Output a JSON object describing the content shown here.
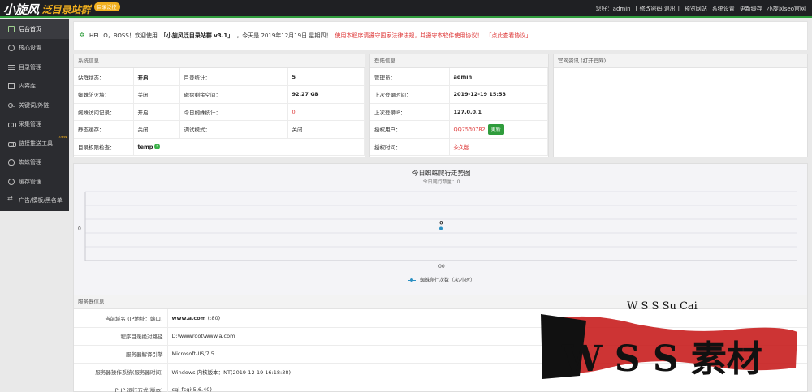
{
  "header": {
    "logo_main": "小旋风",
    "logo_accent": "泛目录站群",
    "logo_badge": "目录泛控",
    "links": [
      "您好：admin",
      "[ 修改密码 退出 ]",
      "预览网站",
      "系统设置",
      "更新缓存",
      "小旋风seo官网"
    ]
  },
  "sidebar": {
    "items": [
      {
        "label": "后台首页",
        "icon": "home-icon"
      },
      {
        "label": "核心设置",
        "icon": "gear-icon"
      },
      {
        "label": "目录管理",
        "icon": "list-icon"
      },
      {
        "label": "内容库",
        "icon": "box-icon"
      },
      {
        "label": "关键词/外链",
        "icon": "key-icon"
      },
      {
        "label": "采集管理",
        "icon": "link-icon"
      },
      {
        "label": "链接推送工具",
        "icon": "push-icon",
        "tag": "new"
      },
      {
        "label": "蜘蛛管理",
        "icon": "bug-icon"
      },
      {
        "label": "缓存管理",
        "icon": "clock-icon"
      },
      {
        "label": "广告/模板/黑名单",
        "icon": "shuffle-icon"
      }
    ]
  },
  "welcome": {
    "greeting": "HELLO，BOSS！欢迎使用",
    "product": "「小旋风泛目录站群 v3.1」",
    "date_text": "，今天是 2019年12月19日 星期四！",
    "notice": "使用本程序请遵守国家法律法规，并遵守本软件使用协议！",
    "link": "「点此查看协议」"
  },
  "system_info": {
    "title": "系统信息",
    "rows": [
      [
        "站群状态：",
        "开启",
        "目录统计：",
        "5"
      ],
      [
        "蜘蛛防火墙：",
        "关闭",
        "磁盘剩余空间：",
        "92.27 GB"
      ],
      [
        "蜘蛛访问记录：",
        "开启",
        "今日蜘蛛统计：",
        "0"
      ],
      [
        "静态缓存：",
        "关闭",
        "调试模式：",
        "关闭"
      ],
      [
        "目录权限检查：",
        "temp",
        "",
        ""
      ]
    ]
  },
  "login_info": {
    "title": "登陆信息",
    "rows": [
      [
        "管理员：",
        "admin"
      ],
      [
        "上次登录时间：",
        "2019-12-19 15:53"
      ],
      [
        "上次登录IP：",
        "127.0.0.1"
      ],
      [
        "授权用户：",
        "QQ7530782"
      ],
      [
        "授权时间：",
        "永久版"
      ]
    ],
    "update_button": "更新"
  },
  "official": {
    "title": "官网资讯 (打开官网)"
  },
  "chart": {
    "title": "今日蜘蛛爬行走势图",
    "subtitle": "今日爬行数量：0",
    "legend": "蜘蛛爬行次数（次/小时）"
  },
  "chart_data": {
    "type": "line",
    "title": "今日蜘蛛爬行走势图",
    "subtitle": "今日爬行数量：0",
    "categories": [
      "00"
    ],
    "series": [
      {
        "name": "蜘蛛爬行次数（次/小时）",
        "values": [
          0
        ]
      }
    ],
    "y_ticks": [
      "0"
    ],
    "grid": true,
    "legend_position": "bottom",
    "color": "#2a8fc2"
  },
  "server_info": {
    "title": "服务器信息",
    "rows": [
      [
        "当前域名 (IP地址：端口)",
        "www.a.com",
        "(:80)"
      ],
      [
        "程序目录绝对路径",
        "D:\\wwwroot\\www.a.com",
        ""
      ],
      [
        "服务器解译引擎",
        "Microsoft-IIS/7.5",
        ""
      ],
      [
        "服务器操作系统(服务器时间)",
        "Windows 内核版本：NT(2019-12-19 16:18:38)",
        ""
      ],
      [
        "PHP 运行方式(版本)",
        "cgi-fcgi(5.6.40)",
        ""
      ]
    ]
  },
  "watermark": {
    "line1": "W S S Su Cai",
    "line2": "W S S 素材"
  },
  "colors": {
    "topbar": "#1f2023",
    "sidebar": "#2b2c30",
    "accent_green": "#2f9c3c",
    "logo_yellow": "#f2b01e",
    "warning_red": "#d33",
    "chart_line": "#2a8fc2"
  }
}
